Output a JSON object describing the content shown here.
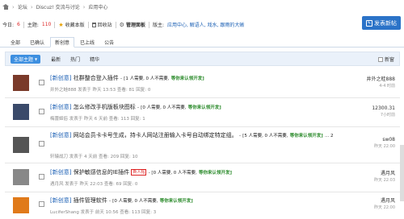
{
  "breadcrumb": {
    "items": [
      "论坛",
      "Discuz! 交流与讨论",
      "应用中心"
    ]
  },
  "stats": {
    "today_label": "今日:",
    "today_value": "6",
    "topics_label": "主题:",
    "topics_value": "110",
    "fav": "收藏本版",
    "recycle": "回收站",
    "manage": "管理面板",
    "moderator_label": "版主:",
    "moderators": "应用中心, 解语人, 戏水, 跟雨的大蜥"
  },
  "post_button": {
    "label": "发表新帖"
  },
  "tabs": [
    "全部",
    "已确认",
    "新创意",
    "已上线",
    "公告"
  ],
  "filter": {
    "theme": "全部主题",
    "items": [
      "最新",
      "热门",
      "精华"
    ],
    "new_label": "新窗"
  },
  "threads": [
    {
      "tag": "[新创意]",
      "title": "社群整合登入插件",
      "dash": "-",
      "stat": "[1 人需要, 0 人不需要,",
      "status": "等你来认领开发]",
      "hot": "",
      "cont": "",
      "author": "井外之蛙888",
      "date": "发表于 昨天 13:53",
      "views": "查看: 81",
      "replies": "回复: 0",
      "last_user": "井外之蛙888",
      "last_time": "4-4 时前",
      "avatar_color": "#7a3a2a"
    },
    {
      "tag": "[新创意]",
      "title": "怎么修改手机版板块图标",
      "dash": "-",
      "stat": "[0 人需要, 0 人不需要,",
      "status": "等你来认领开发]",
      "hot": "",
      "cont": "",
      "author": "梅蕾姬俗",
      "date": "发表于 昨天 6 天前",
      "views": "查看: 113",
      "replies": "回复: 1",
      "last_user": "12300.31",
      "last_time": "7小时前",
      "avatar_color": "#3a4a6a"
    },
    {
      "tag": "[新创意]",
      "title": "网站会员卡卡号生成，持卡人网站注册输入卡号自动绑定特定组。",
      "dash": "-",
      "stat": "[5 人需要, 0 人不需要,",
      "status": "等你来认领开发]",
      "hot": "",
      "cont": "... 2",
      "author": "轩辕战刀",
      "date": "发表于 4 天前",
      "views": "查看: 209",
      "replies": "回复: 10",
      "last_user": "sw08",
      "last_time": "昨天 22:00",
      "avatar_color": "#555"
    },
    {
      "tag": "[新创意]",
      "title": "保护敏感信息的IE插件",
      "dash": "",
      "stat": "- [0 人需要, 0 人不需要,",
      "status": "等你来认领开发]",
      "hot": "新人帖",
      "cont": "",
      "author": "遇月风",
      "date": "发表于 昨天 22:03",
      "views": "查看: 69",
      "replies": "回复: 0",
      "last_user": "遇月风",
      "last_time": "昨天 22:03",
      "avatar_color": "#888"
    },
    {
      "tag": "[新创意]",
      "title": "插件管理软件",
      "dash": "-",
      "stat": "[0 人需要, 0 人不需要,",
      "status": "等你来认领开发]",
      "hot": "",
      "cont": "",
      "author": "LuciferShang",
      "date": "发表于 前天 10:56",
      "views": "查看: 113",
      "replies": "回复: 3",
      "last_user": "遇月风",
      "last_time": "昨天 22:00",
      "avatar_color": "#e07a1a"
    }
  ]
}
